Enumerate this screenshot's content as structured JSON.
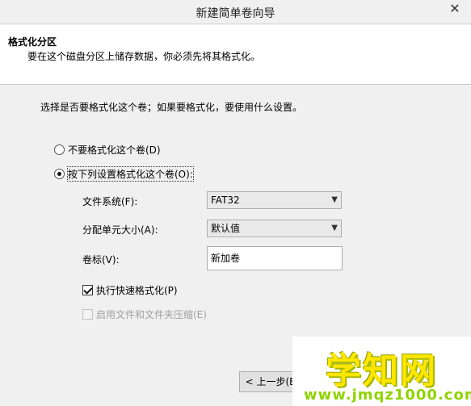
{
  "window": {
    "title": "新建简单卷向导",
    "close_glyph": "✕"
  },
  "header": {
    "title": "格式化分区",
    "subtitle": "要在这个磁盘分区上储存数据，你必须先将其格式化。"
  },
  "intro": "选择是否要格式化这个卷；如果要格式化，要使用什么设置。",
  "options": {
    "no_format": {
      "label": "不要格式化这个卷(D)",
      "selected": false
    },
    "format": {
      "label": "按下列设置格式化这个卷(O):",
      "selected": true
    }
  },
  "fields": {
    "filesystem": {
      "label": "文件系统(F):",
      "value": "FAT32"
    },
    "allocation": {
      "label": "分配单元大小(A):",
      "value": "默认值"
    },
    "volume_label": {
      "label": "卷标(V):",
      "value": "新加卷"
    }
  },
  "checks": {
    "quick_format": {
      "label": "执行快速格式化(P)",
      "checked": true
    },
    "compression": {
      "label": "启用文件和文件夹压缩(E)",
      "checked": false,
      "enabled": false
    }
  },
  "buttons": {
    "back": "< 上一步(B"
  },
  "watermark": {
    "main": "学知网",
    "url": "www.jmqz1000.com"
  },
  "icons": {
    "dropdown": "chevron-down-icon"
  }
}
